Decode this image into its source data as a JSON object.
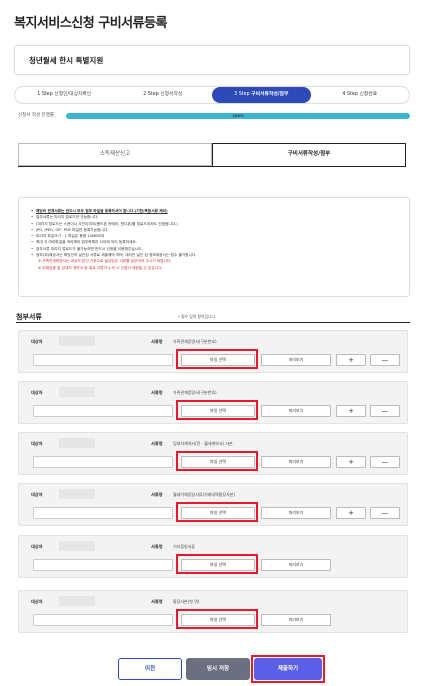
{
  "page_title": "복지서비스신청 구비서류등록",
  "service_name": "청년월세 한시 특별지원",
  "steps": [
    {
      "num": "1 Step",
      "label": "신청인/대상자확인",
      "active": false
    },
    {
      "num": "2 Step",
      "label": "신청서작성",
      "active": false
    },
    {
      "num": "3 Step",
      "label": "구비서류작성/첨부",
      "active": true
    },
    {
      "num": "4 Step",
      "label": "신청완료",
      "active": false
    }
  ],
  "progress": {
    "label": "신청서 작성 진행률",
    "value": 100,
    "text": "100%"
  },
  "tabs": [
    {
      "label": "소득재산신고",
      "active": false
    },
    {
      "label": "구비서류작성/첨부",
      "active": true
    }
  ],
  "notice": [
    "해당의 관계서류는 반드시 모두 첨부 파일을 등록하셔야 합니다.(기한/복합서류 제외)",
    "첨부서류는 미리지 업로드만 가능합니다.",
    "(미리지 업로드는 스캔이나 사진이미지(핸드폰 카메라, 캔디폰)를 업로드하셔도 신청됩니다.)",
    "JPG, JPEG, GIF, PDF 파일만 등록가능합니다.",
    "미리지 파일크기 : 1 파일은 용량 10MB이하",
    "최대 각 마리파일을 여러해의 첨부목록이 사이에 되어 등록하세요.",
    "첨부서류 미리지 업로드가 불가능하면 반드시 신청을 이용해주십시오.",
    "정보(외)제공서는 해당인의 날인된 서류로 제출해야 하며, 대리인 날인 된 정보제공서는 접수 불가합니다.",
    "※ 가족관계증명서는 대상자 본인 기준으로 발급받은 서류를 첨부하여 주시기 바랍니다.",
    "※ 부채입증 및 임대차 계약서 등 필요 서류가 누락 시 신청이 제한될 수 있습니다."
  ],
  "attach_section": {
    "title": "첨부서류",
    "required_note": "* 필수 입력 항목입니다."
  },
  "labels": {
    "target": "대상자",
    "doc_name": "서류명"
  },
  "buttons": {
    "pick_file": "파일 선택",
    "preview": "미리보기",
    "plus": "+",
    "minus": "—"
  },
  "documents": [
    {
      "doc": "가족관계증명서(구분번호)"
    },
    {
      "doc": "가족관계증명서(구분번호)"
    },
    {
      "doc": "임대차계약서(전 · 월세계약서) 사본"
    },
    {
      "doc": "월세이체증빙서류(거래내역통장사본)"
    },
    {
      "doc": "기타증빙서류"
    },
    {
      "doc": "통장사본(첫 면)"
    }
  ],
  "footer": {
    "prev": "이전",
    "temp_save": "임시 저장",
    "submit": "제출하기"
  },
  "colors": {
    "accent": "#2e49b8",
    "progress": "#3bb6cf",
    "highlight": "#e8192c",
    "submit": "#5b5ee6"
  }
}
